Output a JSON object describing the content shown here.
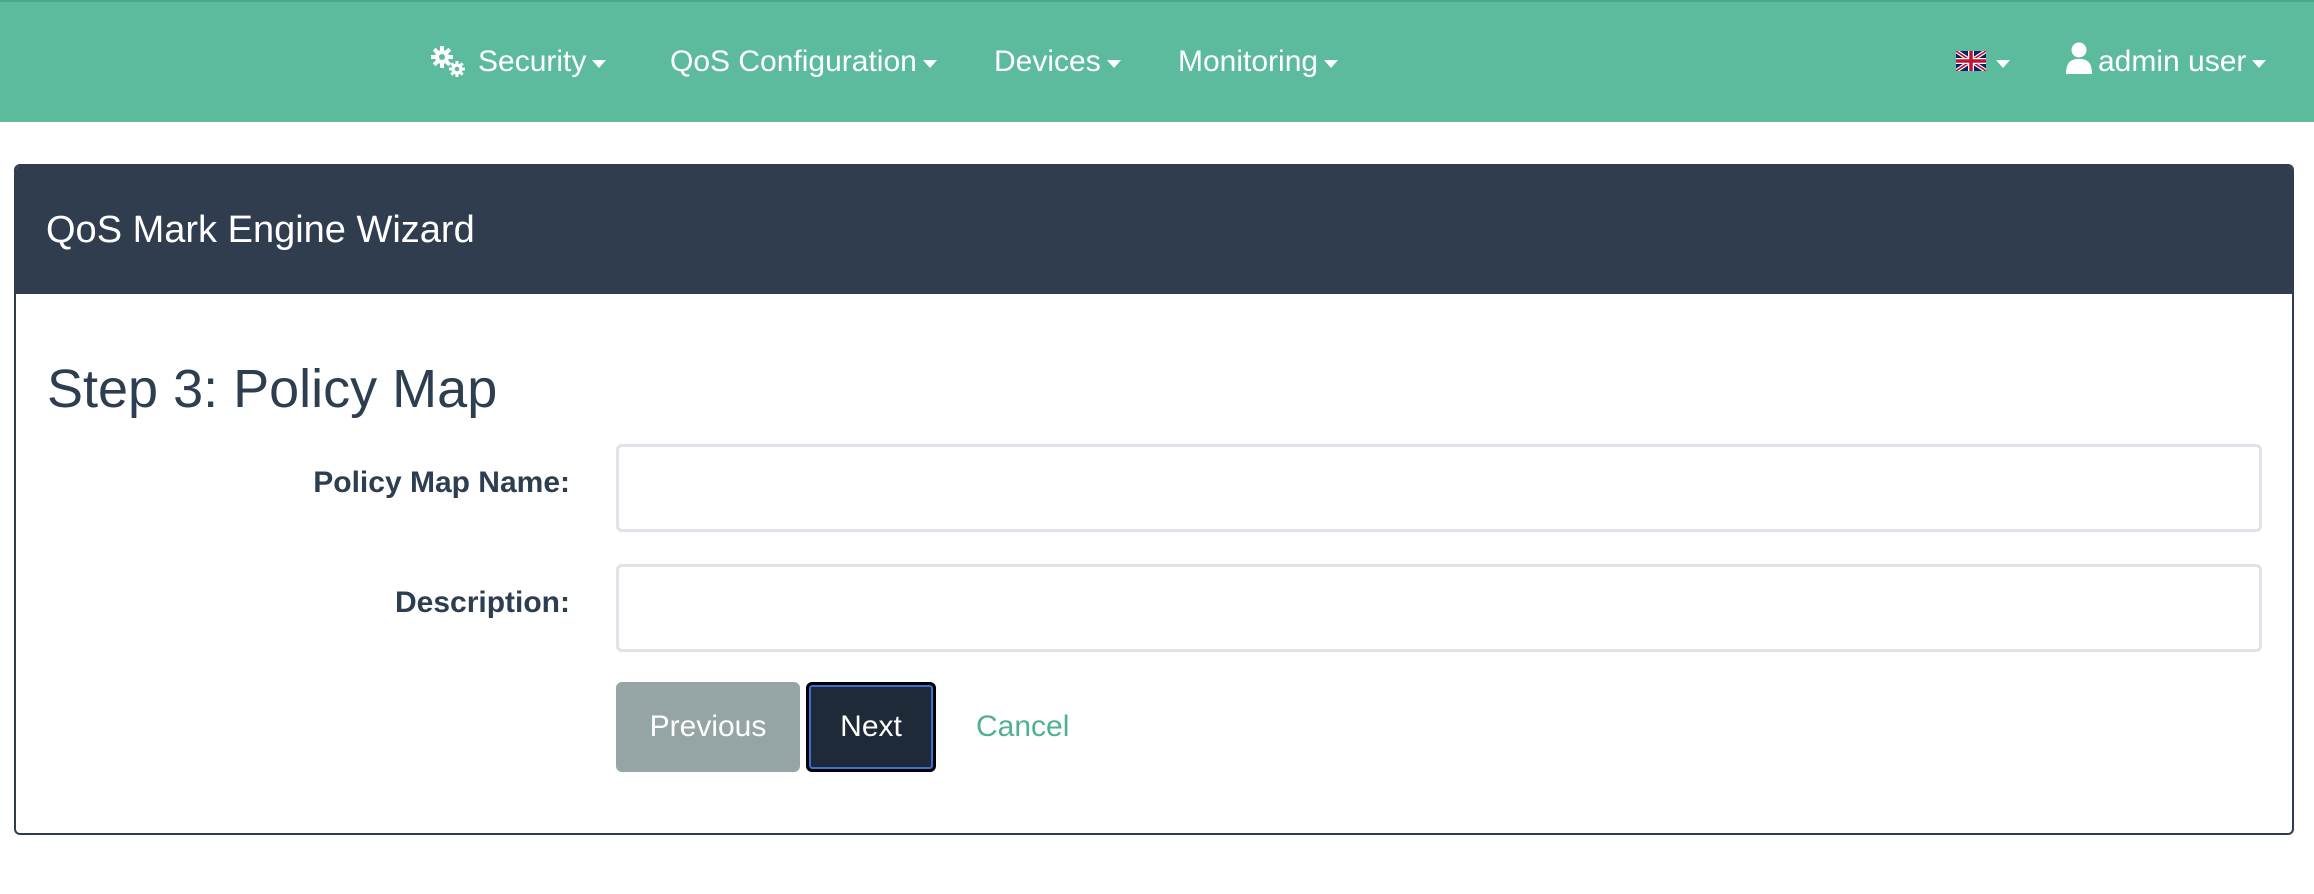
{
  "navbar": {
    "background": "#5bbb9c",
    "items": [
      {
        "label": "Security",
        "icon": "gears-icon"
      },
      {
        "label": "QoS Configuration"
      },
      {
        "label": "Devices"
      },
      {
        "label": "Monitoring"
      }
    ],
    "language_icon": "uk-flag-icon",
    "user": {
      "label": "admin user",
      "icon": "user-icon"
    }
  },
  "panel": {
    "title": "QoS Mark Engine Wizard",
    "header_color": "#2f3d4f"
  },
  "step": {
    "title": "Step 3: Policy Map"
  },
  "form": {
    "policy_map_name": {
      "label": "Policy Map Name:",
      "value": "",
      "placeholder": ""
    },
    "description": {
      "label": "Description:",
      "value": "",
      "placeholder": ""
    }
  },
  "actions": {
    "previous": "Previous",
    "next": "Next",
    "cancel": "Cancel"
  },
  "colors": {
    "accent": "#5bbb9c",
    "link": "#4fb18f",
    "dark": "#2f3d4f",
    "muted_button": "#95a5a6"
  }
}
